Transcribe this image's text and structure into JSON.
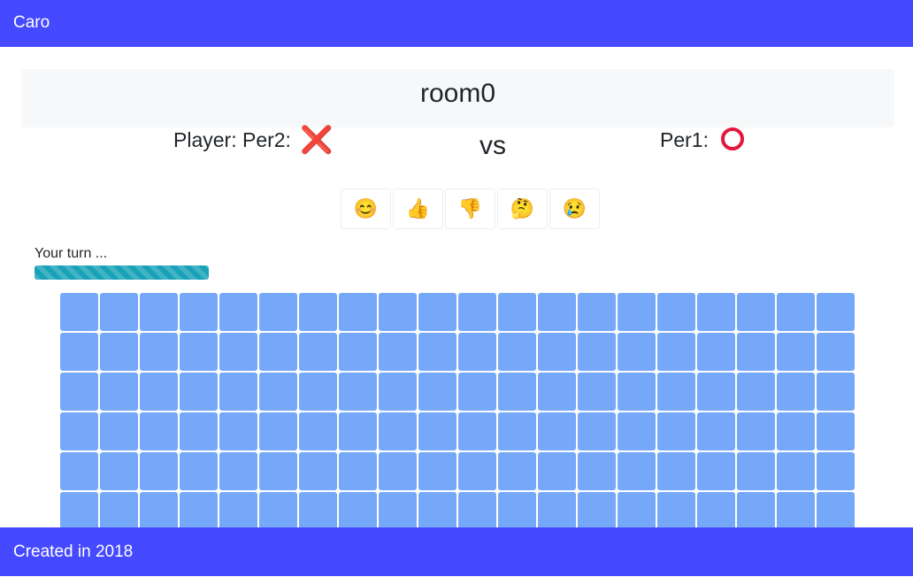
{
  "app": {
    "title": "Caro"
  },
  "room": {
    "name": "room0"
  },
  "players": {
    "left_label": "Player: Per2:",
    "left_symbol": "❌",
    "vs": "vs",
    "right_label": "Per1:",
    "right_symbol": "⭕"
  },
  "reactions": [
    {
      "name": "smile",
      "emoji": "😊"
    },
    {
      "name": "thumbs-up",
      "emoji": "👍"
    },
    {
      "name": "thumbs-down",
      "emoji": "👎"
    },
    {
      "name": "thinking",
      "emoji": "🤔"
    },
    {
      "name": "crying",
      "emoji": "😢"
    }
  ],
  "status": {
    "turn_text": "Your turn ...",
    "timer_progress": 1.0,
    "timer_color": "#17a2b8"
  },
  "board": {
    "columns": 20,
    "visible_rows": 6,
    "cell_color": "#75a8f8"
  },
  "colors": {
    "navbar": "#4549ff",
    "footer": "#4549ff",
    "mark": "#e3163b"
  },
  "footer": {
    "text": "Created in 2018"
  }
}
